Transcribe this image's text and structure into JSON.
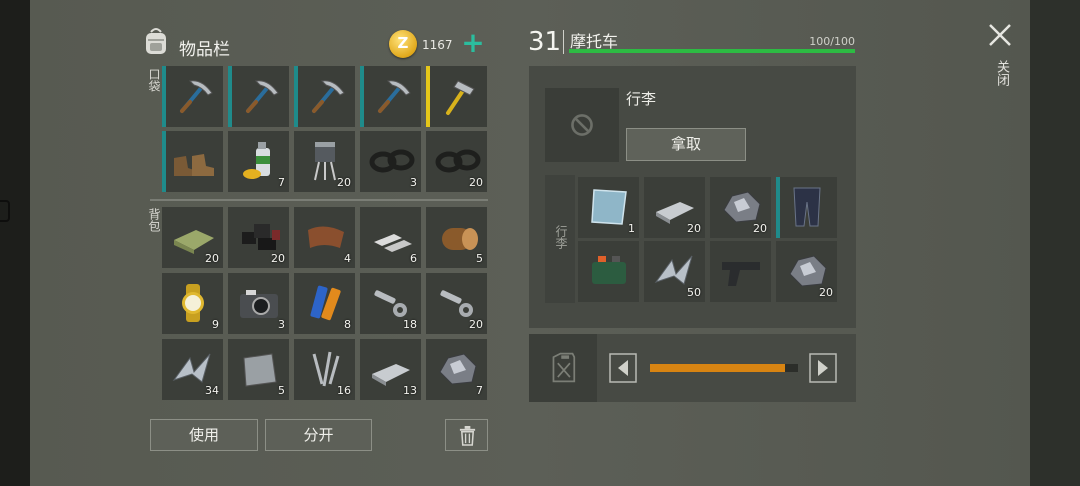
{
  "inventory": {
    "title": "物品栏",
    "coins": "1167",
    "pocket_label": "口袋",
    "backpack_label": "背包",
    "pocket": [
      {
        "icon": "pickaxe-icon",
        "count": "",
        "stripe": "#1f8b8b"
      },
      {
        "icon": "pickaxe-icon",
        "count": "",
        "stripe": "#1f8b8b"
      },
      {
        "icon": "pickaxe-icon",
        "count": "",
        "stripe": "#1f8b8b"
      },
      {
        "icon": "pickaxe-icon",
        "count": "",
        "stripe": "#1f8b8b"
      },
      {
        "icon": "hammer-icon",
        "count": "",
        "stripe": "#e5c71a"
      },
      {
        "icon": "boots-icon",
        "count": "",
        "stripe": "#1f8b8b"
      },
      {
        "icon": "spray-can-icon",
        "count": "7",
        "stripe": ""
      },
      {
        "icon": "transistor-icon",
        "count": "20",
        "stripe": ""
      },
      {
        "icon": "rubber-ring-icon",
        "count": "3",
        "stripe": ""
      },
      {
        "icon": "rubber-ring-icon",
        "count": "20",
        "stripe": ""
      }
    ],
    "backpack": [
      {
        "icon": "cloth-icon",
        "count": "20"
      },
      {
        "icon": "coal-icon",
        "count": "20"
      },
      {
        "icon": "leather-icon",
        "count": "4"
      },
      {
        "icon": "iron-bars-icon",
        "count": "6"
      },
      {
        "icon": "log-icon",
        "count": "5"
      },
      {
        "icon": "wristwatch-icon",
        "count": "9"
      },
      {
        "icon": "camera-icon",
        "count": "3"
      },
      {
        "icon": "batteries-icon",
        "count": "8"
      },
      {
        "icon": "bolt-nut-icon",
        "count": "18"
      },
      {
        "icon": "bolt-nut-icon",
        "count": "20"
      },
      {
        "icon": "scrap-metal-icon",
        "count": "34"
      },
      {
        "icon": "metal-plate-icon",
        "count": "5"
      },
      {
        "icon": "nails-icon",
        "count": "16"
      },
      {
        "icon": "iron-ingot-icon",
        "count": "13"
      },
      {
        "icon": "ore-icon",
        "count": "7"
      }
    ],
    "use_label": "使用",
    "split_label": "分开"
  },
  "vehicle": {
    "level": "31",
    "name": "摩托车",
    "hp_text": "100/100",
    "hp_fraction": 1.0,
    "hp_color": "#2dbb43",
    "luggage_title": "行李",
    "take_label": "拿取",
    "luggage_side_label": "行李",
    "luggage": [
      {
        "icon": "glass-pane-icon",
        "count": "1",
        "stripe": ""
      },
      {
        "icon": "iron-ingot-icon",
        "count": "20",
        "stripe": ""
      },
      {
        "icon": "ore-icon",
        "count": "20",
        "stripe": ""
      },
      {
        "icon": "armored-pants-icon",
        "count": "",
        "stripe": "#1f8b8b"
      },
      {
        "icon": "bomb-icon",
        "count": "",
        "stripe": ""
      },
      {
        "icon": "scrap-metal-icon",
        "count": "50",
        "stripe": ""
      },
      {
        "icon": "pistol-icon",
        "count": "",
        "stripe": ""
      },
      {
        "icon": "ore-icon",
        "count": "20",
        "stripe": ""
      }
    ],
    "fuel_fraction": 0.91,
    "fuel_color": "#d88412"
  },
  "close_label": "关闭"
}
